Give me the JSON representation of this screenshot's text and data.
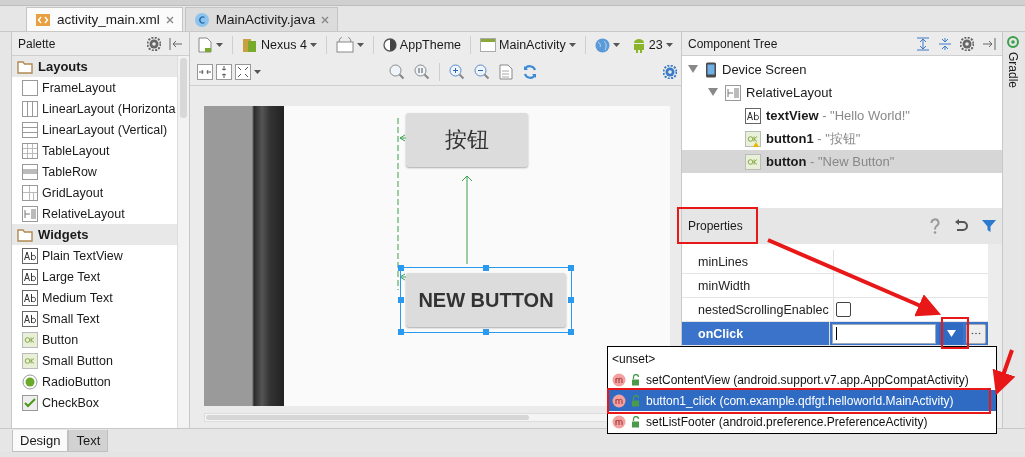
{
  "editor_tabs": [
    {
      "label": "activity_main.xml",
      "kind": "xml",
      "selected": true
    },
    {
      "label": "MainActivity.java",
      "kind": "class",
      "selected": false
    }
  ],
  "palette": {
    "title": "Palette",
    "groups": [
      {
        "label": "Layouts",
        "items": [
          {
            "label": "FrameLayout",
            "kind": "frame"
          },
          {
            "label": "LinearLayout (Horizonta",
            "kind": "linear-h"
          },
          {
            "label": "LinearLayout (Vertical)",
            "kind": "linear-v"
          },
          {
            "label": "TableLayout",
            "kind": "table"
          },
          {
            "label": "TableRow",
            "kind": "tablerow"
          },
          {
            "label": "GridLayout",
            "kind": "grid"
          },
          {
            "label": "RelativeLayout",
            "kind": "relative"
          }
        ]
      },
      {
        "label": "Widgets",
        "items": [
          {
            "label": "Plain TextView",
            "kind": "text"
          },
          {
            "label": "Large Text",
            "kind": "text"
          },
          {
            "label": "Medium Text",
            "kind": "text"
          },
          {
            "label": "Small Text",
            "kind": "text"
          },
          {
            "label": "Button",
            "kind": "button"
          },
          {
            "label": "Small Button",
            "kind": "button"
          },
          {
            "label": "RadioButton",
            "kind": "radio"
          },
          {
            "label": "CheckBox",
            "kind": "checkbox"
          }
        ]
      }
    ]
  },
  "designer_toolbar": {
    "device": "Nexus 4",
    "theme": "AppTheme",
    "activity": "MainActivity",
    "api": "23"
  },
  "canvas": {
    "buttons": [
      {
        "label": "按钮",
        "selected": false
      },
      {
        "label": "NEW BUTTON",
        "selected": true
      }
    ]
  },
  "component_tree": {
    "title": "Component Tree",
    "nodes": [
      {
        "name": "Device Screen",
        "kind": "device",
        "expanded": true,
        "children": [
          {
            "name": "RelativeLayout",
            "kind": "relative",
            "expanded": true,
            "children": [
              {
                "name": "textView",
                "value": "- \"Hello World!\"",
                "kind": "text",
                "warning": false,
                "selected": false
              },
              {
                "name": "button1",
                "value": "- \"按钮\"",
                "kind": "button",
                "warning": true,
                "selected": false
              },
              {
                "name": "button",
                "value": "- \"New Button\"",
                "kind": "button",
                "warning": false,
                "selected": true
              }
            ]
          }
        ]
      }
    ]
  },
  "properties": {
    "title": "Properties",
    "rows": [
      {
        "name": "minLines",
        "kind": "text",
        "selected": false
      },
      {
        "name": "minWidth",
        "kind": "text",
        "selected": false
      },
      {
        "name": "nestedScrollingEnablec",
        "kind": "checkbox",
        "checked": false,
        "selected": false
      },
      {
        "name": "onClick",
        "kind": "dropdown",
        "selected": true
      }
    ]
  },
  "dropdown": {
    "items": [
      {
        "label": "<unset>",
        "kind": "plain",
        "selected": false
      },
      {
        "label": "setContentView",
        "detail": "(android.support.v7.app.AppCompatActivity)",
        "kind": "method",
        "selected": false
      },
      {
        "label": "button1_click",
        "detail": "(com.example.qdfgt.helloworld.MainActivity)",
        "kind": "method",
        "selected": true
      },
      {
        "label": "setListFooter",
        "detail": "(android.preference.PreferenceActivity)",
        "kind": "method",
        "selected": false
      }
    ]
  },
  "bottom_tabs": [
    {
      "label": "Design",
      "selected": true
    },
    {
      "label": "Text",
      "selected": false
    }
  ],
  "side_tool": {
    "label": "Gradle"
  }
}
